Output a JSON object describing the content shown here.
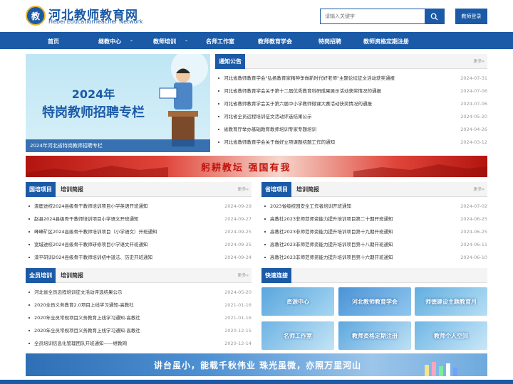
{
  "header": {
    "logo_mark": "教",
    "title_cn": "河北教师教育网",
    "title_en": "Hebei EducationTeacher  Network",
    "search_placeholder": "请输入关键字",
    "login_label": "教师登录"
  },
  "nav": {
    "items": [
      {
        "label": "首页",
        "caret": false
      },
      {
        "label": "继教中心",
        "caret": true
      },
      {
        "label": "教师培训",
        "caret": true
      },
      {
        "label": "名师工作室",
        "caret": false
      },
      {
        "label": "教师教育学会",
        "caret": false
      },
      {
        "label": "特岗招聘",
        "caret": false
      },
      {
        "label": "教师资格定期注册",
        "caret": false
      }
    ]
  },
  "banner": {
    "line1": "2024年",
    "line2": "特岗教师招聘专栏",
    "caption": "2024年河北省特岗教师招聘专栏"
  },
  "notice": {
    "title": "通知公告",
    "more": "更多»",
    "items": [
      {
        "text": "河北省教师教育学会\"弘扬教育家精神争做新时代好老师\"主题论坛征文活动获奖通报",
        "date": "2024-07-31"
      },
      {
        "text": "河北省教师教育学会关于第十二届优秀教育科研成果展示活动获奖情况的通报",
        "date": "2024-07-06"
      },
      {
        "text": "河北省教师教育学会关于第六届中小学教师微课大赛活动获奖情况的通报",
        "date": "2024-07-06"
      },
      {
        "text": "河北省全员远程培训征文活动评选结果公示",
        "date": "2024-05-20"
      },
      {
        "text": "省教育厅举办基础教育教师培训专家专题培训",
        "date": "2024-04-26"
      },
      {
        "text": "河北省教师教育学会关于做好立项课题结题工作的通知",
        "date": "2024-03-12"
      }
    ]
  },
  "strip": {
    "text": "躬耕教坛   强国有我"
  },
  "guopei": {
    "tab": "国培项目",
    "sub": "培训简报",
    "more": "更多»",
    "items": [
      {
        "text": "涿鹿进校2024县级骨干教师培训项目小学英语开班通知",
        "date": "2024-09-29"
      },
      {
        "text": "赵县2024县级骨干教师培训项目小学语文开班通知",
        "date": "2024-09-27"
      },
      {
        "text": "峰峰矿区2024县级骨干教师培训项目（小学语文）开班通知",
        "date": "2024-09-25"
      },
      {
        "text": "宽城进校2024县级骨干教师研修项目小学语文开班通知",
        "date": "2024-09-25"
      },
      {
        "text": "滦平研训2024县级骨干教师培训初中道法、历史开班通知",
        "date": "2024-09-24"
      }
    ]
  },
  "shengpei": {
    "tab": "省培项目",
    "sub": "培训简报",
    "more": "更多»",
    "items": [
      {
        "text": "2023省级校园安全工作者培训开班通知",
        "date": "2024-07-02"
      },
      {
        "text": "高教社2023非师范师资能力提升培训项目第二十期开班通知",
        "date": "2024-06-25"
      },
      {
        "text": "高教社2023非师范师资能力提升培训项目第十九期开班通知",
        "date": "2024-06-25"
      },
      {
        "text": "高教社2023非师范师资能力提升培训项目第十八期开班通知",
        "date": "2024-06-11"
      },
      {
        "text": "高教社2023非师范师资能力提升培训项目第十六期开班通知",
        "date": "2024-06-10"
      }
    ]
  },
  "quanyuan": {
    "tab": "全员培训",
    "sub": "培训简报",
    "more": "更多»",
    "items": [
      {
        "text": "河北省全员远程培训征文活动评选结果公示",
        "date": "2024-05-20"
      },
      {
        "text": "2020全员义务教育2.0项目上线学习通知-高教社",
        "date": "2021-01-16"
      },
      {
        "text": "2020年全员常规项目义务教育上线学习通知-高教社",
        "date": "2021-01-16"
      },
      {
        "text": "2020年全员常规项目义务教育上线学习通知-高教社",
        "date": "2020-12-15"
      },
      {
        "text": "全员培训信息化管理团队开班通知——继教网",
        "date": "2020-12-14"
      }
    ]
  },
  "quick": {
    "title": "快速连接",
    "tiles": [
      "资源中心",
      "河北教师教育学会",
      "师德建设主题教育月",
      "名师工作室",
      "教师资格定期注册",
      "教师个人空间"
    ]
  },
  "bottom": {
    "text": "讲台虽小，能载千秋伟业   珠光虽微，亦照万里河山"
  },
  "colors": {
    "primary": "#1b5aa6",
    "red": "#c0130c"
  }
}
